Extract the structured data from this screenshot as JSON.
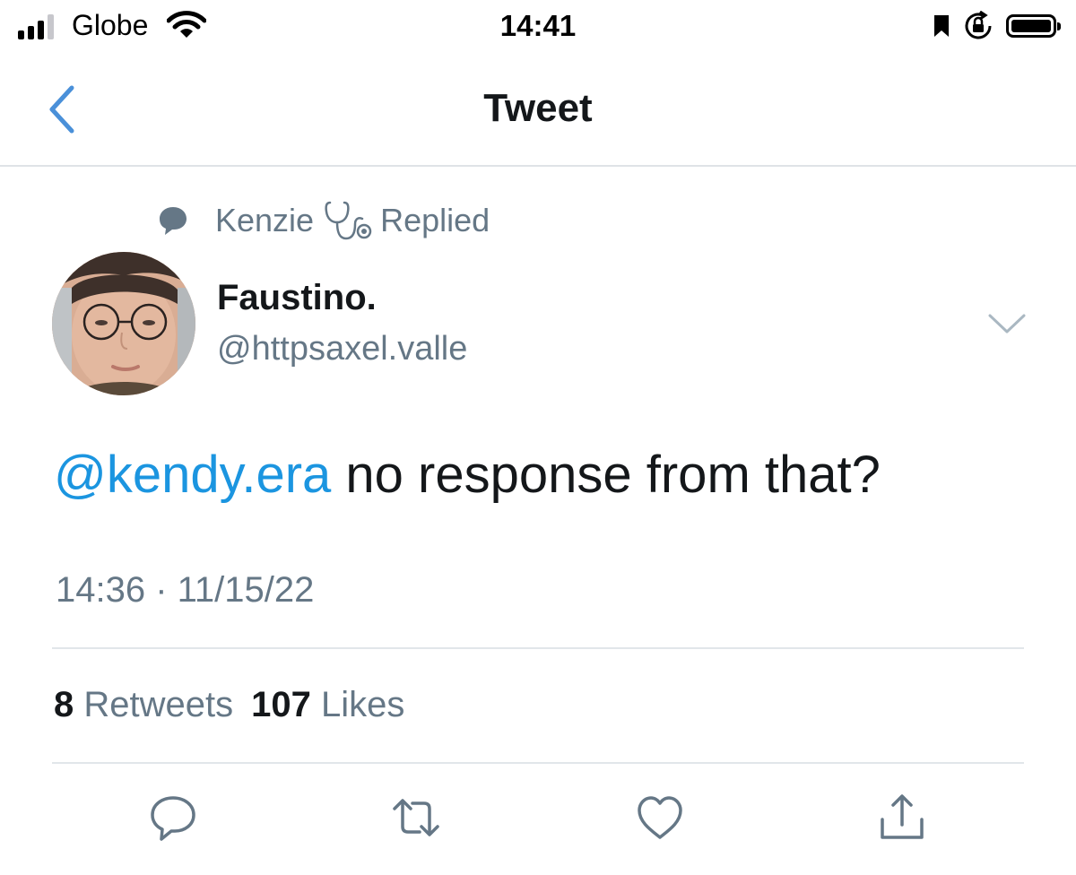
{
  "status_bar": {
    "carrier": "Globe",
    "time": "14:41",
    "signal_bars_active": 3,
    "signal_bars_total": 4,
    "battery_level": 0.92
  },
  "nav": {
    "title": "Tweet",
    "back_icon": "chevron-left-icon"
  },
  "context": {
    "replier_name": "Kenzie",
    "replied_label": "Replied",
    "icons": [
      "speech-bubble-icon",
      "stethoscope-icon"
    ]
  },
  "author": {
    "display_name": "Faustino.",
    "handle": "@httpsaxel.valle"
  },
  "tweet": {
    "mention": "@kendy.era",
    "text": " no response from that?",
    "timestamp": "14:36 · 11/15/22"
  },
  "stats": {
    "retweets_count": "8",
    "retweets_label": "Retweets",
    "likes_count": "107",
    "likes_label": "Likes"
  },
  "actions": [
    {
      "icon": "reply-icon"
    },
    {
      "icon": "retweet-icon"
    },
    {
      "icon": "like-icon"
    },
    {
      "icon": "share-icon"
    }
  ],
  "colors": {
    "link_blue": "#1b95e0",
    "nav_blue": "#4a90d9",
    "secondary_gray": "#657786",
    "icon_gray": "#657786",
    "divider": "#e1e6ea"
  }
}
